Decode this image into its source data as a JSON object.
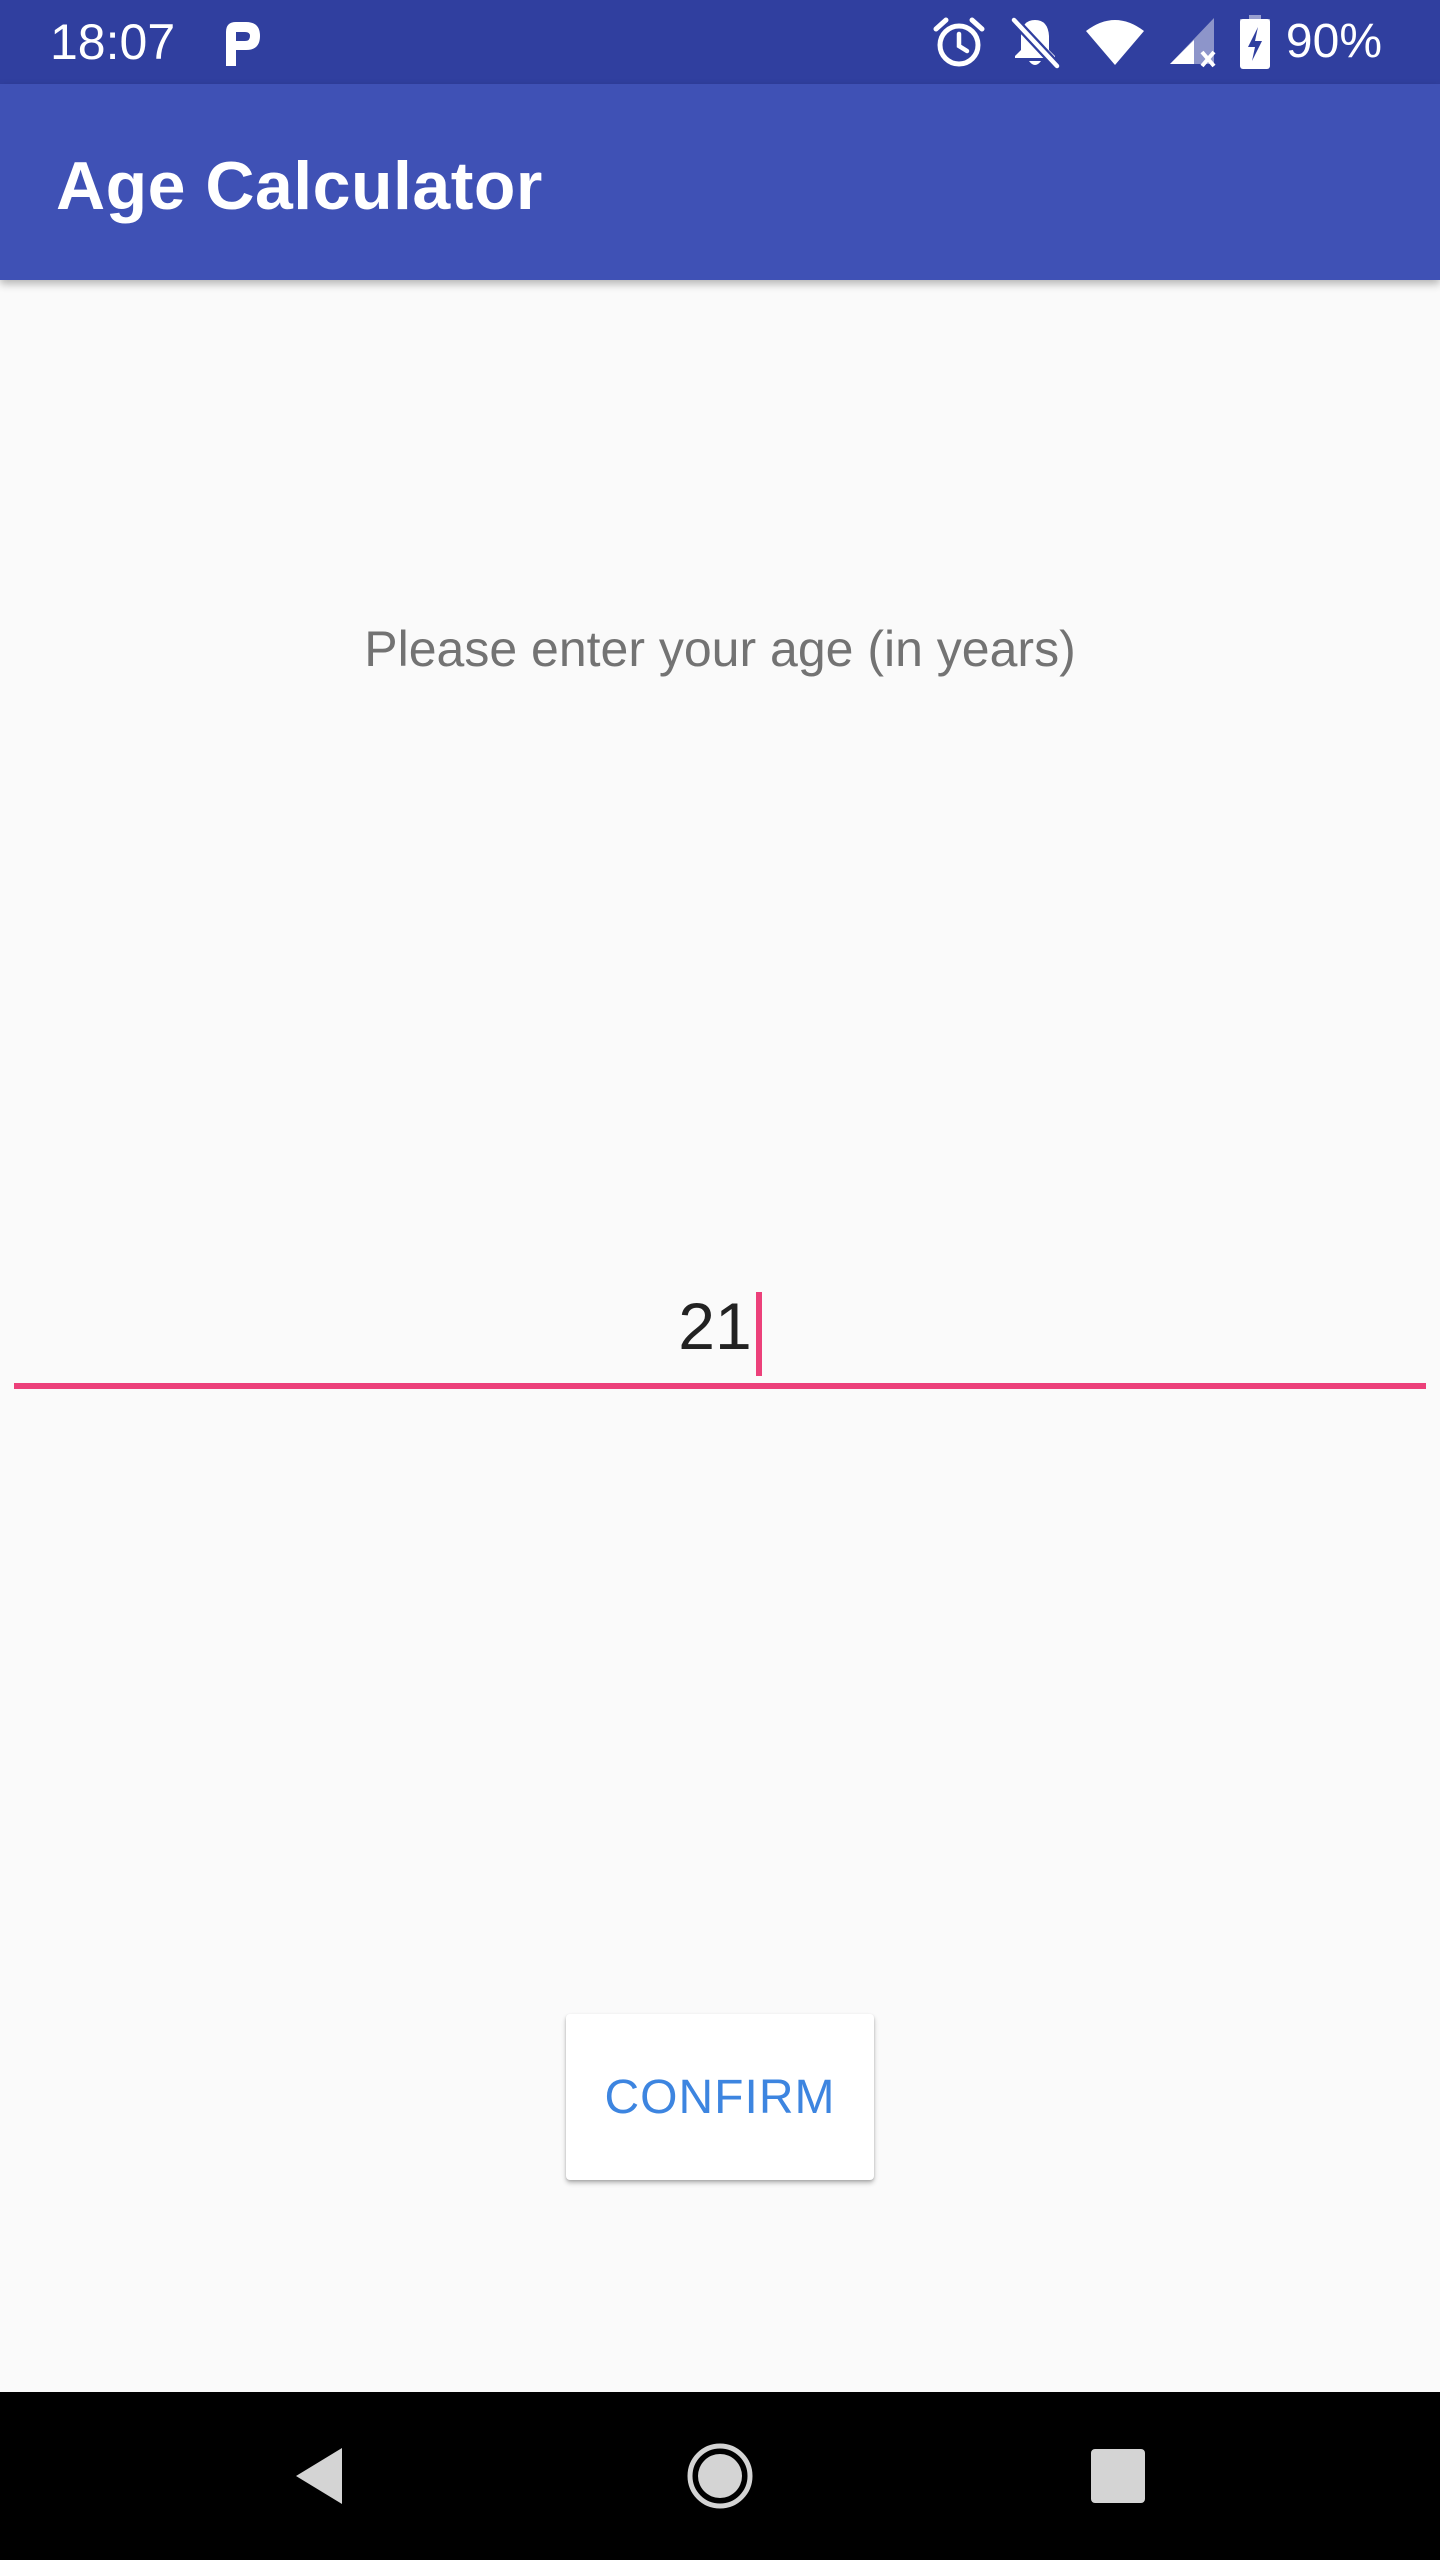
{
  "status_bar": {
    "time": "18:07",
    "battery_percent": "90%",
    "icons": [
      "parking-p-icon",
      "alarm-icon",
      "notifications-off-icon",
      "wifi-icon",
      "cell-signal-no-data-icon",
      "battery-charging-icon"
    ]
  },
  "app_bar": {
    "title": "Age Calculator"
  },
  "main": {
    "prompt": "Please enter your age (in years)",
    "age_input_value": "21",
    "confirm_label": "CONFIRM"
  },
  "nav_bar": {
    "icons": [
      "back-icon",
      "home-icon",
      "recents-icon"
    ]
  },
  "colors": {
    "status_bar": "#303f9f",
    "app_bar": "#3f51b5",
    "accent": "#ec407a",
    "button_text": "#3d85e0",
    "background": "#fafafa"
  }
}
